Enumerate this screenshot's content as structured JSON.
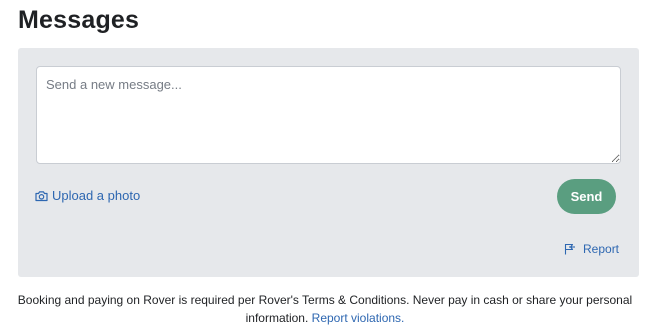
{
  "page": {
    "title": "Messages"
  },
  "composer": {
    "placeholder": "Send a new message...",
    "value": "",
    "upload_label": "Upload a photo",
    "upload_icon": "camera-icon",
    "send_label": "Send",
    "report_label": "Report",
    "report_icon": "flag-icon"
  },
  "footer": {
    "notice_text": "Booking and paying on Rover is required per Rover's Terms & Conditions. Never pay in cash or share your personal information.",
    "report_violations_label": "Report violations."
  },
  "colors": {
    "accent_link": "#2e67b1",
    "send_button": "#5a9e80",
    "composer_background": "#e6e8eb"
  }
}
